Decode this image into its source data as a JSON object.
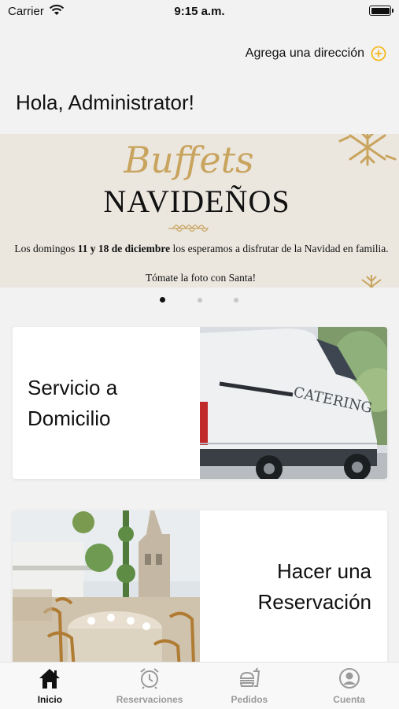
{
  "status_bar": {
    "carrier": "Carrier",
    "time": "9:15 a.m."
  },
  "header": {
    "address_label": "Agrega una dirección",
    "greeting": "Hola, Administrator!"
  },
  "accent_color": "#f5b91e",
  "banner": {
    "script_title": "Buffets",
    "title": "NAVIDEÑOS",
    "text_before": "Los domingos ",
    "text_bold": "11 y 18 de diciembre",
    "text_after": " los esperamos a disfrutar de la Navidad en familia.",
    "text_2": "Tómate la foto con Santa!",
    "dots_count": 3,
    "active_dot_index": 0
  },
  "cards": [
    {
      "title": "Servicio a Domicilio",
      "image_icon": "delivery-van-image"
    },
    {
      "title": "Hacer una Reservación",
      "image_icon": "restaurant-terrace-image"
    }
  ],
  "tabs": [
    {
      "label": "Inicio",
      "icon": "home-icon",
      "active": true
    },
    {
      "label": "Reservaciones",
      "icon": "alarm-clock-icon",
      "active": false
    },
    {
      "label": "Pedidos",
      "icon": "burger-drink-icon",
      "active": false
    },
    {
      "label": "Cuenta",
      "icon": "user-circle-icon",
      "active": false
    }
  ]
}
